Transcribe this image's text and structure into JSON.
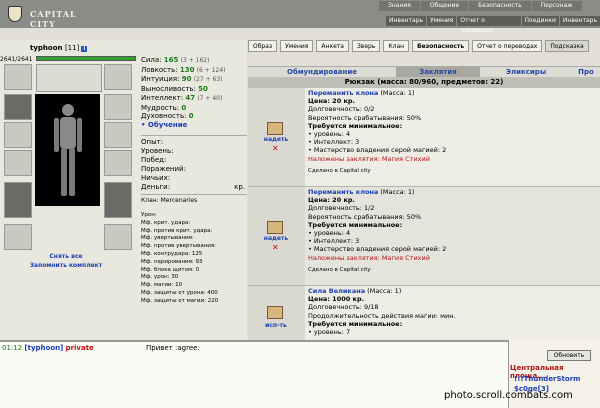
{
  "site": {
    "name": "CAPITAL CITY"
  },
  "top_nav": [
    "Знания",
    "Общение",
    "Безопасность",
    "Персонаж"
  ],
  "sub_nav": [
    "Инвентарь",
    "Умения",
    "Отчет о переводах",
    "Поединки",
    "Инвентарь"
  ],
  "player": {
    "name": "typhoon",
    "level": "[11]",
    "hp": "2641/2641",
    "badge": "i"
  },
  "stats": [
    {
      "label": "Сила:",
      "value": "165",
      "extra": "(3 + 162)"
    },
    {
      "label": "Ловкость:",
      "value": "130",
      "extra": "(6 + 124)"
    },
    {
      "label": "Интуиция:",
      "value": "90",
      "extra": "(27 + 63)"
    },
    {
      "label": "Выносливость:",
      "value": "50",
      "extra": ""
    },
    {
      "label": "Интеллект:",
      "value": "47",
      "extra": "(7 + 40)"
    },
    {
      "label": "Мудрость:",
      "value": "0",
      "extra": ""
    },
    {
      "label": "Духовность:",
      "value": "0",
      "extra": ""
    }
  ],
  "learn_link": "• Обучение",
  "battle": [
    "Опыт:",
    "Уровень:",
    "Побед:",
    "Поражений:",
    "Ничьих:",
    "Деньги:"
  ],
  "money_unit": "кр.",
  "clan": "Клан: Mercenaries",
  "mods": [
    "Урон:",
    "Мф. крит. удара:",
    "Мф. против крит. удара:",
    "Мф. увертывания:",
    "Мф. против увертывания:",
    "Мф. контрудара: 125",
    "Мф. парирования: 93",
    "Мф. блока щитом: 0",
    "Мф. урон: 30",
    "Мф. магии: 10",
    "Мф. защиты от урона: 400",
    "Мф. защиты от магии: 220"
  ],
  "left_links": [
    "Снять все",
    "Запомнить комплект"
  ],
  "tabs": [
    "Образ",
    "Умения",
    "Анкета",
    "Зверь",
    "Клан",
    "Безопасность",
    "Отчет о переводах",
    "Подсказка"
  ],
  "categories": [
    "Обмундирование",
    "Заклятия",
    "Эликсиры",
    "Про"
  ],
  "backpack_title": "Рюкзак (масса: 80/960, предметов: 22)",
  "items": [
    {
      "name": "Переманить клона",
      "mass": "(Масса: 1)",
      "price": "Цена: 20 кр.",
      "durability": "Долговечность: 0/2",
      "chance": "Вероятность срабатывания: 50%",
      "req_title": "Требуется минимальное:",
      "reqs": [
        "• уровень: 4",
        "• Интеллект: 3",
        "• Мастерство владения серой магией: 2"
      ],
      "spell": "Наложены заклятия: Магия Стихий",
      "made": "Сделано в Capital city",
      "action": "надеть"
    },
    {
      "name": "Переманить клона",
      "mass": "(Масса: 1)",
      "price": "Цена: 20 кр.",
      "durability": "Долговечность: 1/2",
      "chance": "Вероятность срабатывания: 50%",
      "req_title": "Требуется минимальное:",
      "reqs": [
        "• уровень: 4",
        "• Интеллект: 3",
        "• Мастерство владения серой магией: 2"
      ],
      "spell": "Наложены заклятия: Магия Стихий",
      "made": "Сделано в Capital city",
      "action": "надеть"
    },
    {
      "name": "Сила Великана",
      "mass": "(Масса: 1)",
      "price": "Цена: 1000 кр.",
      "durability": "Долговечность: 9/18",
      "chance": "Продолжительность действия магии:        мин.",
      "req_title": "Требуется минимальное:",
      "reqs": [
        "• уровень: 7"
      ],
      "spell": "",
      "made": "",
      "action": "исп-ть"
    }
  ],
  "chat": {
    "time": "01:12",
    "nick": "[typhoon]",
    "private": "private",
    "message": "Привет :agree:"
  },
  "right": {
    "refresh": "Обновить",
    "plaza": "Центральная площа...",
    "users": [
      "!!!ThunderStorm",
      "$c0ge[3]"
    ]
  },
  "watermark": "photo.scroll.combats.com"
}
